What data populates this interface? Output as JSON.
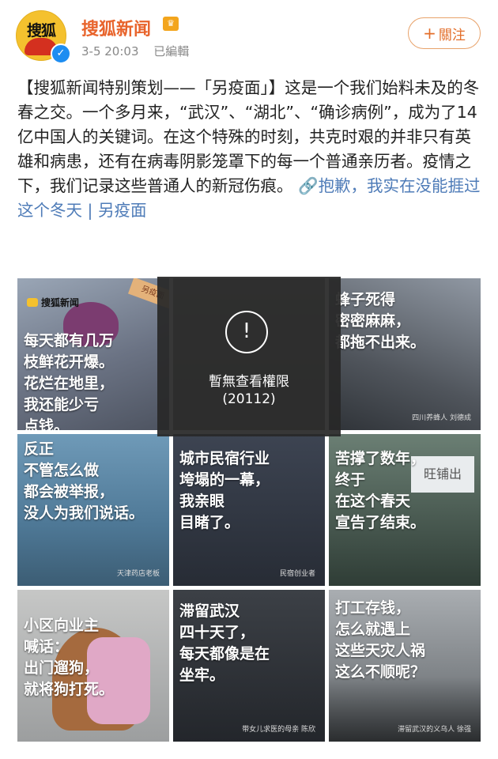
{
  "header": {
    "avatar_text": "搜狐",
    "username": "搜狐新闻",
    "crown_icon": "vip-crown",
    "verified_icon": "verified-check",
    "date": "3-5 20:03",
    "edited": "已編輯",
    "follow_label": "關注",
    "follow_icon": "+"
  },
  "post": {
    "text": "【搜狐新闻特别策划——「另疫面」】这是一个我们始料未及的冬春之交。一个多月来，“武汉”、“湖北”、“确诊病例”，成为了14亿中国人的关键词。在这个特殊的时刻，共克时艰的并非只有英雄和病患，还有在病毒阴影笼罩下的每一个普通亲历者。疫情之下，我们记录这些普通人的新冠伤痕。",
    "link_icon": "🔗",
    "link_text": "抱歉，我实在没能捱过这个冬天",
    "separator": " | ",
    "topic": "另疫面"
  },
  "grid": {
    "tiles": [
      {
        "caption": "每天都有几万\n枝鲜花开爆。\n花烂在地里，\n我还能少亏\n点钱。",
        "brand": "搜狐新闻",
        "tag": "另疫面",
        "credit": ""
      },
      {
        "caption": "",
        "brand": "",
        "tag": "",
        "credit": ""
      },
      {
        "caption": "蜂子死得\n密密麻麻，\n都拖不出来。",
        "brand": "",
        "tag": "",
        "credit": "四川养蜂人 刘德成"
      },
      {
        "caption": "反正\n不管怎么做\n都会被举报，\n没人为我们说话。",
        "brand": "",
        "tag": "",
        "credit": "天津药店老板"
      },
      {
        "caption": "城市民宿行业\n垮塌的一幕，\n我亲眼\n目睹了。",
        "brand": "",
        "tag": "",
        "credit": "民宿创业者"
      },
      {
        "caption": "苦撑了数年，\n终于\n在这个春天\n宣告了结束。",
        "brand": "",
        "tag": "",
        "credit": "",
        "shop_sign": "旺铺出"
      },
      {
        "caption": "小区向业主\n喊话：\n出门遛狗，\n就将狗打死。",
        "brand": "",
        "tag": "",
        "credit": ""
      },
      {
        "caption": "滞留武汉\n四十天了，\n每天都像是在\n坐牢。",
        "brand": "",
        "tag": "",
        "credit": "带女儿求医的母亲 陈欣"
      },
      {
        "caption": "打工存钱，\n怎么就遇上\n这些天灾人祸\n这么不顺呢？",
        "brand": "",
        "tag": "",
        "credit": "滞留武汉的义乌人 徐强"
      }
    ]
  },
  "overlay": {
    "icon": "!",
    "message": "暫無查看權限",
    "code": "(20112)"
  }
}
